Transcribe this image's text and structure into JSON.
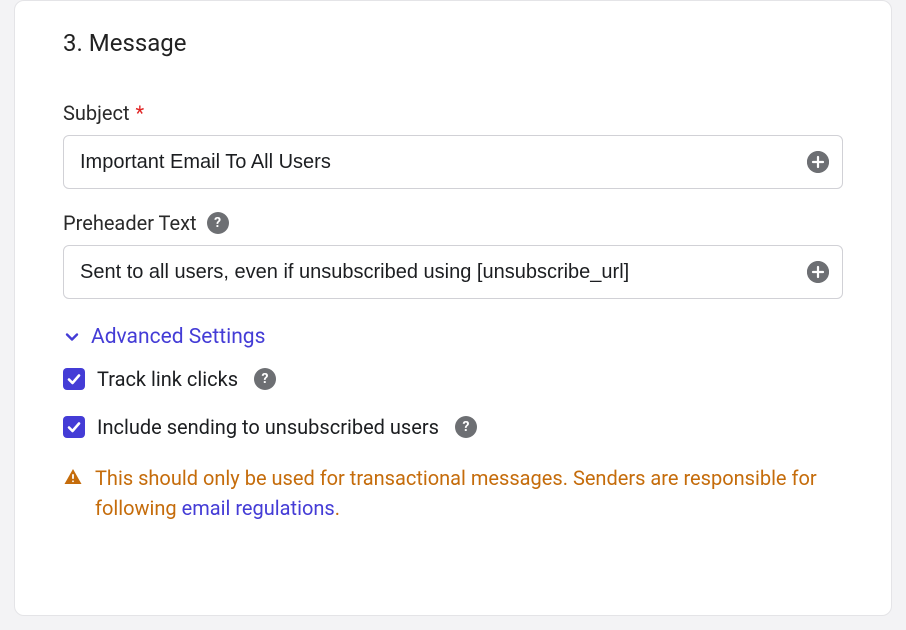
{
  "section": {
    "title": "3. Message"
  },
  "subject": {
    "label": "Subject",
    "required_marker": "*",
    "value": "Important Email To All Users"
  },
  "preheader": {
    "label": "Preheader Text",
    "value": "Sent to all users, even if unsubscribed using [unsubscribe_url]"
  },
  "advanced": {
    "label": "Advanced Settings"
  },
  "check_track": {
    "label": "Track link clicks",
    "checked": true
  },
  "check_unsub": {
    "label": "Include sending to unsubscribed users",
    "checked": true
  },
  "warning": {
    "text_a": "This should only be used for transactional messages. Senders are responsible for following ",
    "link": "email regulations",
    "text_b": "."
  },
  "help_glyph": "?"
}
